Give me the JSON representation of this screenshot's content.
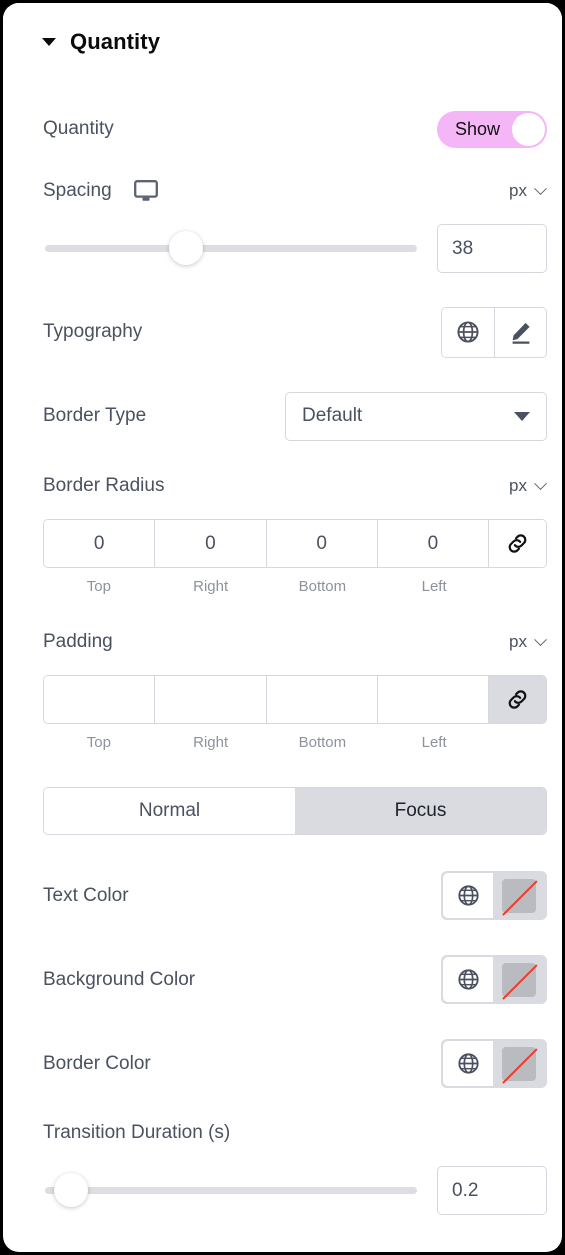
{
  "panel": {
    "section_title": "Quantity",
    "collapse_icon": "caret-down-icon"
  },
  "rows": {
    "quantity": {
      "label": "Quantity",
      "toggle_label": "Show",
      "toggle_state": "on",
      "toggle_color": "#f4b6f6"
    },
    "spacing": {
      "label": "Spacing",
      "device_icon": "desktop-monitor-icon",
      "unit": "px",
      "value": "38",
      "slider_percent": 38
    },
    "typography": {
      "label": "Typography",
      "globe_icon": "globe-icon",
      "edit_icon": "pencil-edit-icon"
    },
    "border_type": {
      "label": "Border Type",
      "value": "Default"
    },
    "border_radius": {
      "label": "Border Radius",
      "unit": "px",
      "values": [
        "0",
        "0",
        "0",
        "0"
      ],
      "sides": [
        "Top",
        "Right",
        "Bottom",
        "Left"
      ],
      "link_icon": "link-icon",
      "linked": false
    },
    "padding": {
      "label": "Padding",
      "unit": "px",
      "values": [
        "",
        "",
        "",
        ""
      ],
      "sides": [
        "Top",
        "Right",
        "Bottom",
        "Left"
      ],
      "link_icon": "link-icon",
      "linked": true
    },
    "state_tabs": {
      "tabs": [
        "Normal",
        "Focus"
      ],
      "active": "Focus"
    },
    "text_color": {
      "label": "Text Color",
      "globe_icon": "globe-icon",
      "swatch_icon": "no-color-slash-icon",
      "swatch_value": "transparent"
    },
    "background_color": {
      "label": "Background Color",
      "globe_icon": "globe-icon",
      "swatch_icon": "no-color-slash-icon",
      "swatch_value": "transparent"
    },
    "border_color": {
      "label": "Border Color",
      "globe_icon": "globe-icon",
      "swatch_icon": "no-color-slash-icon",
      "swatch_value": "transparent"
    },
    "transition_duration": {
      "label": "Transition Duration (s)",
      "value": "0.2",
      "slider_percent": 7
    }
  }
}
